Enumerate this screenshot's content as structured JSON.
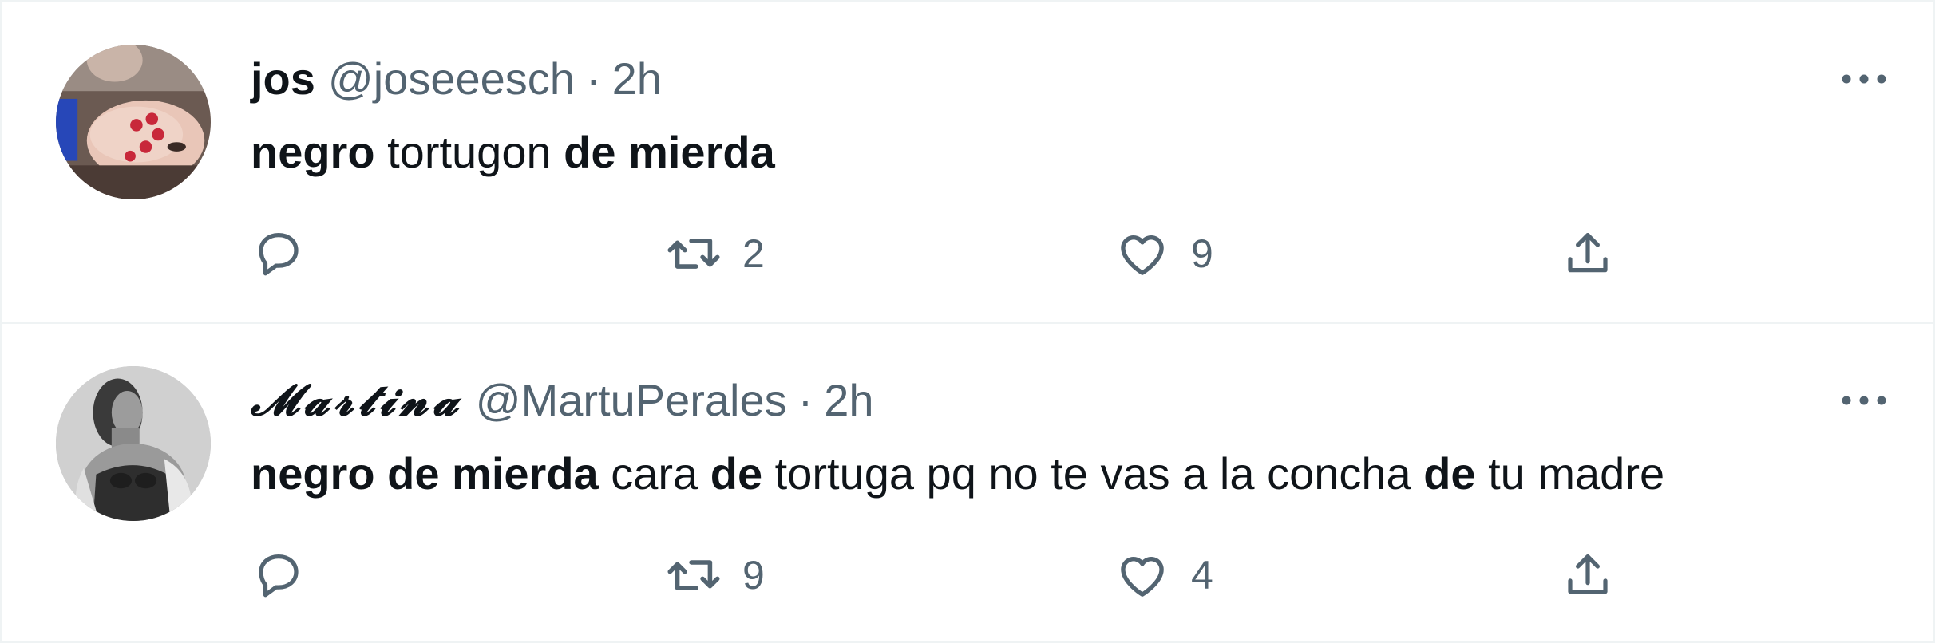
{
  "tweets": [
    {
      "name": "jos",
      "name_style": "bold",
      "handle": "@joseeesch",
      "separator": "·",
      "time": "2h",
      "text_segments": [
        {
          "text": "negro",
          "bold": true
        },
        {
          "text": " tortugon ",
          "bold": false
        },
        {
          "text": "de mierda",
          "bold": true
        }
      ],
      "reply_count": "",
      "retweet_count": "2",
      "like_count": "9",
      "icons": {
        "reply": "reply-icon",
        "retweet": "retweet-icon",
        "like": "heart-icon",
        "share": "share-icon",
        "more": "more-icon"
      }
    },
    {
      "name": "𝓜𝓪𝓻𝓽𝓲𝓷𝓪",
      "name_style": "script",
      "handle": "@MartuPerales",
      "separator": "·",
      "time": "2h",
      "text_segments": [
        {
          "text": "negro de mierda",
          "bold": true
        },
        {
          "text": " cara ",
          "bold": false
        },
        {
          "text": "de",
          "bold": true
        },
        {
          "text": " tortuga pq no te vas a la concha ",
          "bold": false
        },
        {
          "text": "de",
          "bold": true
        },
        {
          "text": " tu madre",
          "bold": false
        }
      ],
      "reply_count": "",
      "retweet_count": "9",
      "like_count": "4",
      "icons": {
        "reply": "reply-icon",
        "retweet": "retweet-icon",
        "like": "heart-icon",
        "share": "share-icon",
        "more": "more-icon"
      }
    }
  ],
  "colors": {
    "text_primary": "#0f1419",
    "text_secondary": "#536471",
    "divider": "#eff3f4",
    "background": "#ffffff"
  }
}
